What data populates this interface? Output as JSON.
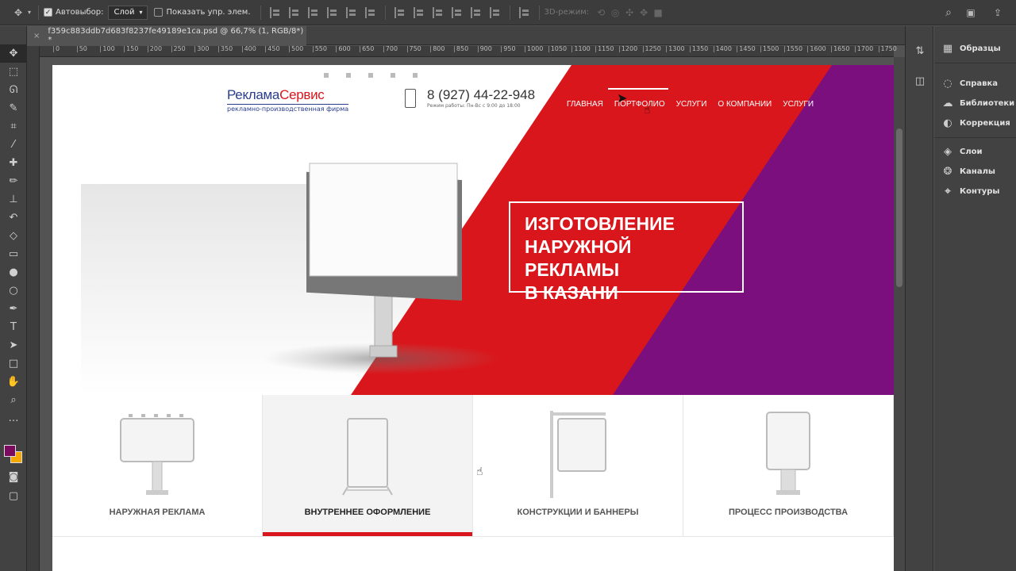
{
  "options_bar": {
    "autoselect_label": "Автовыбор:",
    "autoselect_value": "Слой",
    "show_controls_label": "Показать упр. элем.",
    "mode_3d_label": "3D-режим:"
  },
  "document_tab": {
    "title": "f359c883ddb7d683f8237fe49189e1ca.psd @ 66,7% (1, RGB/8*) *"
  },
  "ruler": {
    "ticks": [
      "0",
      "50",
      "100",
      "150",
      "200",
      "250",
      "300",
      "350",
      "400",
      "450",
      "500",
      "550",
      "600",
      "650",
      "700",
      "750",
      "800",
      "850",
      "900",
      "950",
      "1000",
      "1050",
      "1100",
      "1150",
      "1200",
      "1250",
      "1300",
      "1350",
      "1400",
      "1450",
      "1500",
      "1550",
      "1600",
      "1650",
      "1700",
      "1750"
    ]
  },
  "panels": {
    "items": [
      {
        "label": "Образцы",
        "icon": "grid-icon"
      },
      {
        "label": "Справка",
        "icon": "lightbulb-icon"
      },
      {
        "label": "Библиотеки",
        "icon": "cloud-icon"
      },
      {
        "label": "Коррекция",
        "icon": "circle-half-icon"
      },
      {
        "label": "Слои",
        "icon": "layers-icon"
      },
      {
        "label": "Каналы",
        "icon": "channels-icon"
      },
      {
        "label": "Контуры",
        "icon": "paths-icon"
      }
    ]
  },
  "colors": {
    "foreground": "#7b0b5e",
    "background": "#f5a800",
    "brand_red": "#d9161b",
    "brand_purple": "#7a0f7d"
  },
  "site": {
    "logo_part1": "Реклама",
    "logo_part2": "Сервис",
    "logo_tagline": "рекламно-производственная фирма",
    "phone": "8 (927) 44-22-948",
    "hours": "Режим работы: Пн-Вс с 9:00 до 18:00",
    "nav": [
      "ГЛАВНАЯ",
      "ПОРТФОЛИО",
      "УСЛУГИ",
      "О КОМПАНИИ",
      "УСЛУГИ"
    ],
    "headline_1": "ИЗГОТОВЛЕНИЕ",
    "headline_2": "НАРУЖНОЙ РЕКЛАМЫ",
    "headline_3": "В КАЗАНИ",
    "categories": [
      "НАРУЖНАЯ РЕКЛАМА",
      "ВНУТРЕННЕЕ ОФОРМЛЕНИЕ",
      "КОНСТРУКЦИИ И БАННЕРЫ",
      "ПРОЦЕСС ПРОИЗВОДСТВА"
    ]
  }
}
